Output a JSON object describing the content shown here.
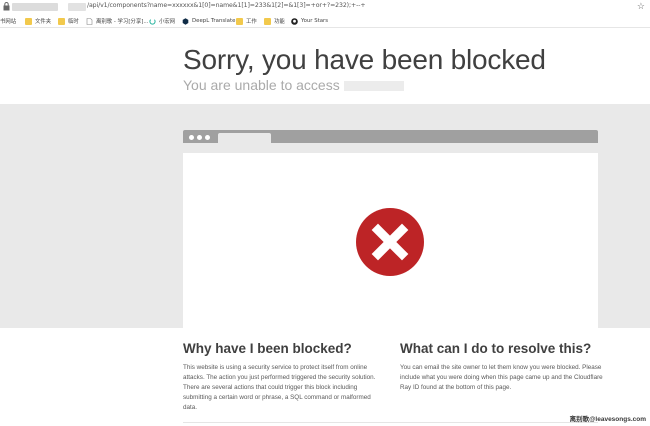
{
  "address_bar": {
    "url": "/api/v1/components?name=xxxxxx&1[0]=name&1[1]=233&1[2]=&1[3]=+or+?=232);+--+"
  },
  "bookmarks": [
    {
      "label": "书网站",
      "icon": "folder-icon"
    },
    {
      "label": "文件夹",
      "icon": "folder-icon"
    },
    {
      "label": "临时",
      "icon": "folder-icon"
    },
    {
      "label": "离别歌 - 学习[分享]...",
      "icon": "page-icon"
    },
    {
      "label": "小宏网",
      "icon": "loader-icon"
    },
    {
      "label": "DeepL Translate",
      "icon": "deepl-icon"
    },
    {
      "label": "工作",
      "icon": "folder-icon"
    },
    {
      "label": "功能",
      "icon": "folder-icon"
    },
    {
      "label": "Your Stars",
      "icon": "github-icon"
    }
  ],
  "header": {
    "title": "Sorry, you have been blocked",
    "subtitle": "You are unable to access"
  },
  "left_column": {
    "title": "Why have I been blocked?",
    "text": "This website is using a security service to protect itself from online attacks. The action you just performed triggered the security solution. There are several actions that could trigger this block including submitting a certain word or phrase, a SQL command or malformed data."
  },
  "right_column": {
    "title": "What can I do to resolve this?",
    "text": "You can email the site owner to let them know you were blocked. Please include what you were doing when this page came up and the Cloudflare Ray ID found at the bottom of this page."
  },
  "watermark": "离别歌@leavesongs.com",
  "colors": {
    "error_red": "#bd2426",
    "band_gray": "#e9e9e9",
    "mock_gray": "#a0a0a0",
    "folder_yellow": "#f2c94c"
  }
}
